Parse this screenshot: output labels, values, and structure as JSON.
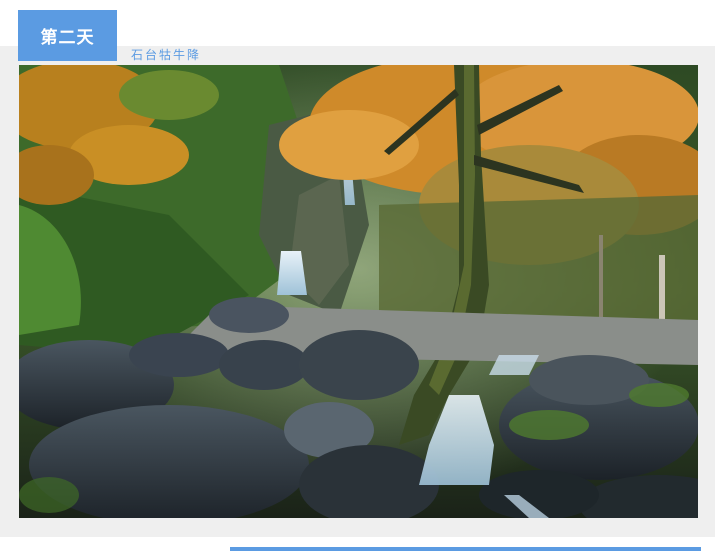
{
  "header": {
    "day_label": "第二天",
    "subtitle": "石台牯牛降"
  },
  "colors": {
    "accent": "#5b9be2",
    "panel": "#efefef"
  },
  "photo": {
    "subject": "waterfall-forest-photo"
  }
}
